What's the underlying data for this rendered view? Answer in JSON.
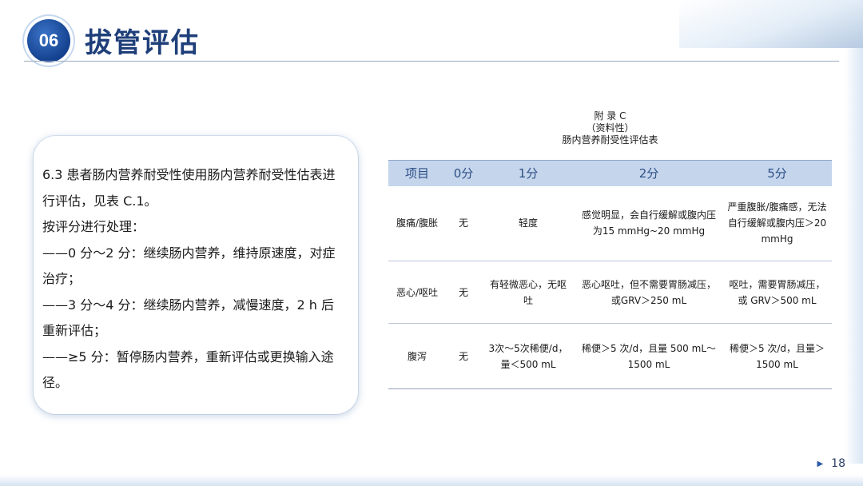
{
  "header": {
    "number": "06",
    "title": "拔管评估"
  },
  "text_card": {
    "lines": [
      "6.3 患者肠内营养耐受性使用肠内营养耐受性估表进行评估，见表 C.1。",
      "按评分进行处理：",
      "——0 分～2 分：继续肠内营养，维持原速度，对症治疗；",
      "——3 分～4 分：继续肠内营养，减慢速度，2 h 后重新评估；",
      "——≥5 分：暂停肠内营养，重新评估或更换输入途径。"
    ]
  },
  "table": {
    "caption_line1": "附 录 C",
    "caption_line2": "（资料性）",
    "caption_line3": "肠内营养耐受性评估表",
    "headers": [
      "项目",
      "0分",
      "1分",
      "2分",
      "5分"
    ],
    "rows": [
      [
        "腹痛/腹胀",
        "无",
        "轻度",
        "感觉明显，会自行缓解或腹内压为15 mmHg~20 mmHg",
        "严重腹胀/腹痛感，无法自行缓解或腹内压＞20 mmHg"
      ],
      [
        "恶心/呕吐",
        "无",
        "有轻微恶心，无呕吐",
        "恶心呕吐，但不需要胃肠减压，或GRV＞250 mL",
        "呕吐，需要胃肠减压，或 GRV＞500 mL"
      ],
      [
        "腹泻",
        "无",
        "3次～5次稀便/d，量＜500 mL",
        "稀便＞5 次/d，且量 500 mL～1500 mL",
        "稀便＞5 次/d，且量＞1500 mL"
      ]
    ]
  },
  "footer": {
    "page_number": "18",
    "arrow_icon": "play-arrow-icon"
  },
  "colors": {
    "accent": "#1f3f7a",
    "badge": "#14418f",
    "table_header_bg": "#c5d5ec"
  }
}
